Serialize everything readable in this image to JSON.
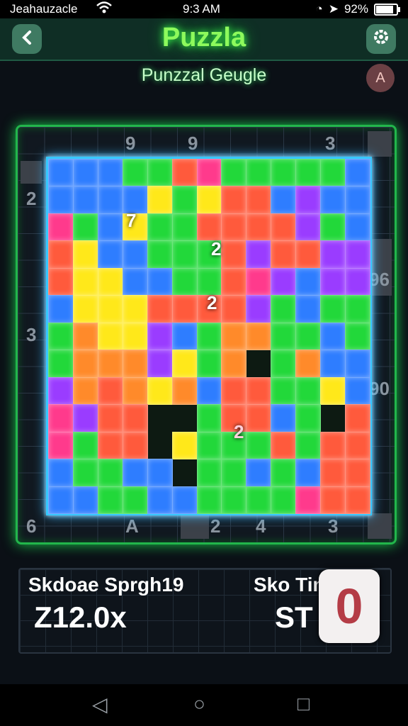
{
  "status_bar": {
    "carrier": "Jeahauzacle",
    "time": "9:3 AM",
    "battery": "92%",
    "battery_level": 0.92,
    "icons": [
      "wifi-icon",
      "alarm-icon",
      "location-icon",
      "signal-icon",
      "battery-icon"
    ]
  },
  "header": {
    "title": "Puzzla",
    "back_icon": "chevron-left-icon",
    "settings_icon": "gear-icon"
  },
  "subtitle": "Punzzal Geugle",
  "hint_label": "A",
  "board": {
    "edge_numbers": [
      "9",
      "9",
      "3",
      "4",
      "2",
      "96",
      "3",
      "90",
      "6",
      "A",
      "2",
      "4",
      "3"
    ],
    "piece_numbers": [
      "7",
      "2",
      "2",
      "2"
    ],
    "colors": {
      "red": "#ff5a3c",
      "orange": "#ff8a2a",
      "yellow": "#ffe81a",
      "green": "#22d83a",
      "blue": "#2e7dff",
      "purple": "#9a3cff",
      "magenta": "#ff3a8c"
    },
    "frame_color": "#22b64b",
    "puzzle_border_color": "#36c8ff"
  },
  "stats": {
    "score_label": "Skdoae Sprgh19",
    "score_value": "Z12.0x",
    "time_label": "Sko Tim",
    "time_value": "ST",
    "badge_text": "0"
  },
  "navbar": {
    "back": "◁",
    "home": "○",
    "recents": "□"
  }
}
